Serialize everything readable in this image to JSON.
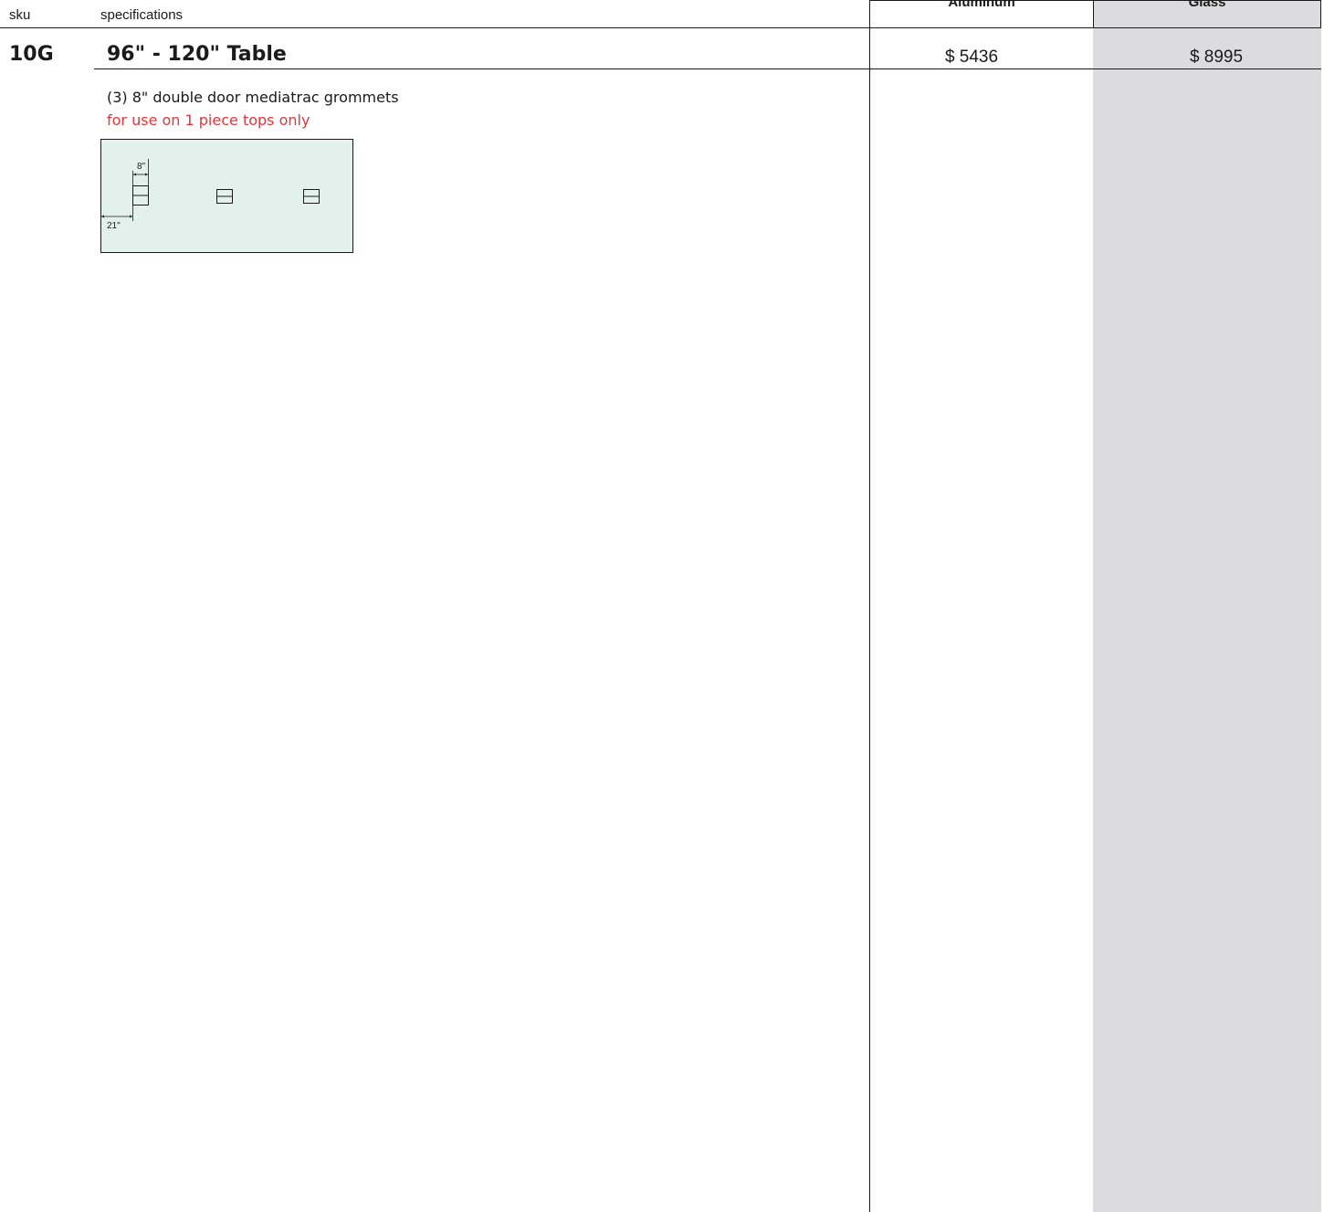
{
  "header": {
    "sku_label": "sku",
    "spec_label": "specifications",
    "columns": [
      "Aluminum",
      "Glass"
    ]
  },
  "product": {
    "sku": "10G",
    "title": "96\" - 120\" Table",
    "prices": {
      "aluminum": "$ 5436",
      "glass": "$ 8995"
    },
    "spec": "(3) 8\" double door mediatrac grommets",
    "note": "for use on 1 piece tops only",
    "diagram": {
      "width_label": "8\"",
      "offset_label": "21\""
    }
  },
  "colors": {
    "note": "#e8343a",
    "glass_column": "#dcdcde",
    "diagram_fill": "#e3f1ec"
  }
}
